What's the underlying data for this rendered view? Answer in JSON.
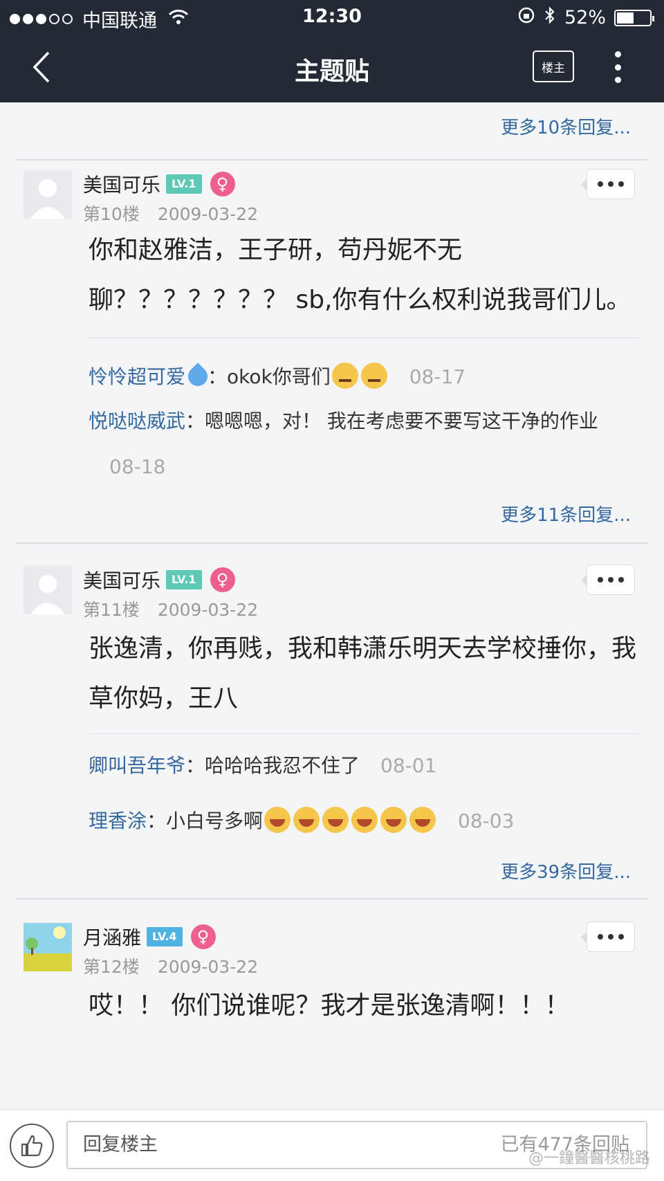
{
  "status_bar": {
    "carrier": "中国联通",
    "time": "12:30",
    "battery": "52%",
    "battery_level": 0.52
  },
  "nav": {
    "title": "主题贴",
    "owner_label": "楼主"
  },
  "top_more": "更多10条回复...",
  "posts": [
    {
      "username": "美国可乐",
      "level": "LV.1",
      "gender": "♀",
      "floor": "第10楼",
      "date": "2009-03-22",
      "content": "你和赵雅洁，王子研，苟丹妮不无聊？？？？？？？ sb,你有什么权利说我哥们儿。",
      "replies": [
        {
          "user": "怜怜超可爱",
          "text": "okok你哥们",
          "time": "08-17"
        },
        {
          "user": "悦哒哒威武",
          "text": "嗯嗯嗯，对！ 我在考虑要不要写这干净的作业",
          "time": "08-18"
        }
      ],
      "more": "更多11条回复..."
    },
    {
      "username": "美国可乐",
      "level": "LV.1",
      "gender": "♀",
      "floor": "第11楼",
      "date": "2009-03-22",
      "content": "张逸清，你再贱，我和韩潇乐明天去学校捶你，我草你妈，王八",
      "replies": [
        {
          "user": "卿叫吾年爷",
          "text": "哈哈哈我忍不住了",
          "time": "08-01"
        },
        {
          "user": "理香涂",
          "text": "小白号多啊",
          "time": "08-03"
        }
      ],
      "more": "更多39条回复..."
    },
    {
      "username": "月涵雅",
      "level": "LV.4",
      "gender": "♀",
      "floor": "第12楼",
      "date": "2009-03-22",
      "content": "哎！！ 你们说谁呢？我才是张逸清啊！！！"
    }
  ],
  "bottom": {
    "reply_placeholder": "回复楼主",
    "reply_count": "已有477条回贴",
    "watermark": "@一鐘醫醫核桃路"
  },
  "colors": {
    "navbar": "#232a36",
    "link": "#35689f",
    "female": "#ef5f8e"
  }
}
